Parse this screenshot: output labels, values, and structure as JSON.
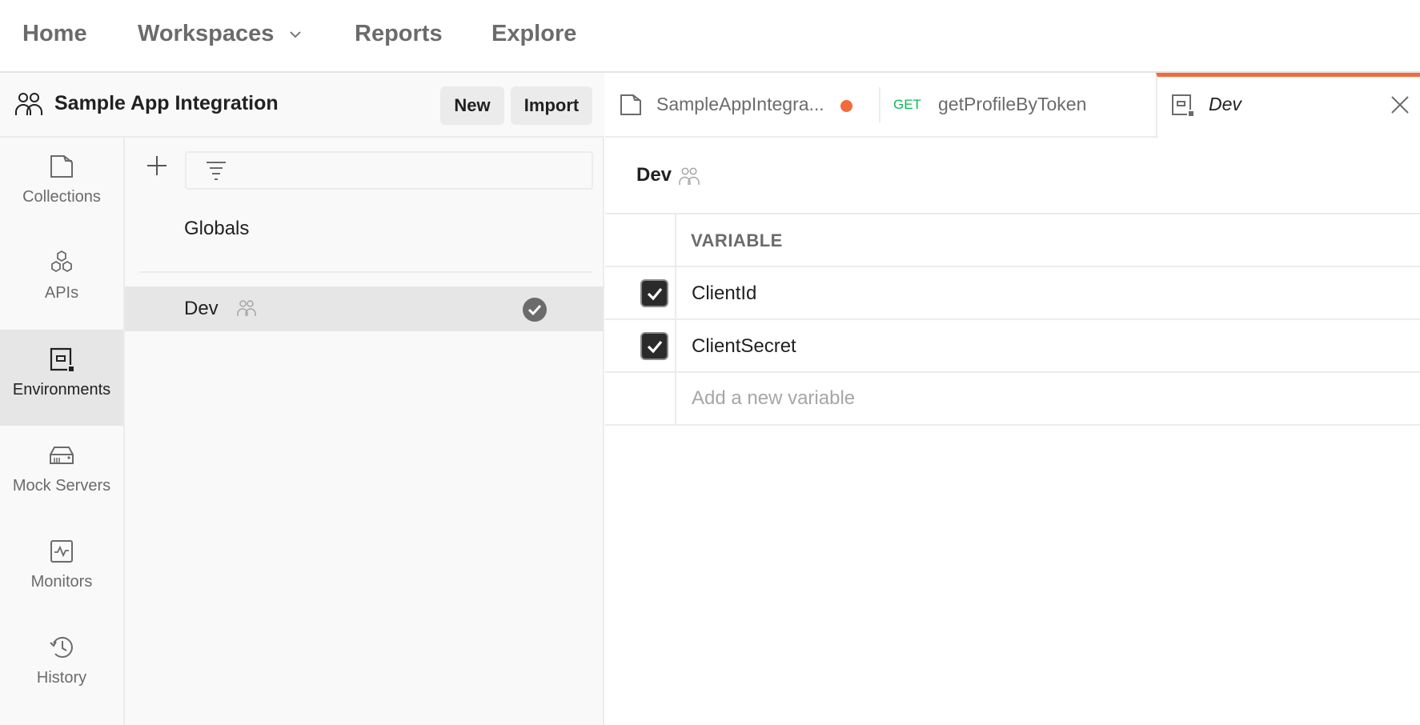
{
  "topnav": {
    "items": [
      {
        "label": "Home"
      },
      {
        "label": "Workspaces",
        "has_dropdown": true
      },
      {
        "label": "Reports"
      },
      {
        "label": "Explore"
      }
    ]
  },
  "workspace": {
    "title": "Sample App Integration",
    "icon": "team-icon",
    "new_label": "New",
    "import_label": "Import"
  },
  "rail": {
    "items": [
      {
        "label": "Collections",
        "icon": "collections-icon",
        "active": false
      },
      {
        "label": "APIs",
        "icon": "apis-icon",
        "active": false
      },
      {
        "label": "Environments",
        "icon": "environments-icon",
        "active": true
      },
      {
        "label": "Mock Servers",
        "icon": "mock-server-icon",
        "active": false
      },
      {
        "label": "Monitors",
        "icon": "monitor-icon",
        "active": false
      },
      {
        "label": "History",
        "icon": "history-icon",
        "active": false
      }
    ]
  },
  "environments": {
    "filter_placeholder": "",
    "items": [
      {
        "name": "Globals",
        "shared": false,
        "active": false
      },
      {
        "name": "Dev",
        "shared": true,
        "active": true
      }
    ]
  },
  "tabs": [
    {
      "label": "SampleAppIntegra...",
      "icon": "collection-icon",
      "unsaved": true
    },
    {
      "label": "getProfileByToken",
      "method": "GET"
    },
    {
      "label": "Dev",
      "icon": "environment-icon",
      "active": true
    }
  ],
  "editor": {
    "env_name": "Dev",
    "column_header": "VARIABLE",
    "variables": [
      {
        "name": "ClientId",
        "enabled": true
      },
      {
        "name": "ClientSecret",
        "enabled": true
      }
    ],
    "add_placeholder": "Add a new variable"
  },
  "colors": {
    "accent": "#f26b3a",
    "method_get": "#0cbb52",
    "active_bg": "#e6e6e6"
  }
}
